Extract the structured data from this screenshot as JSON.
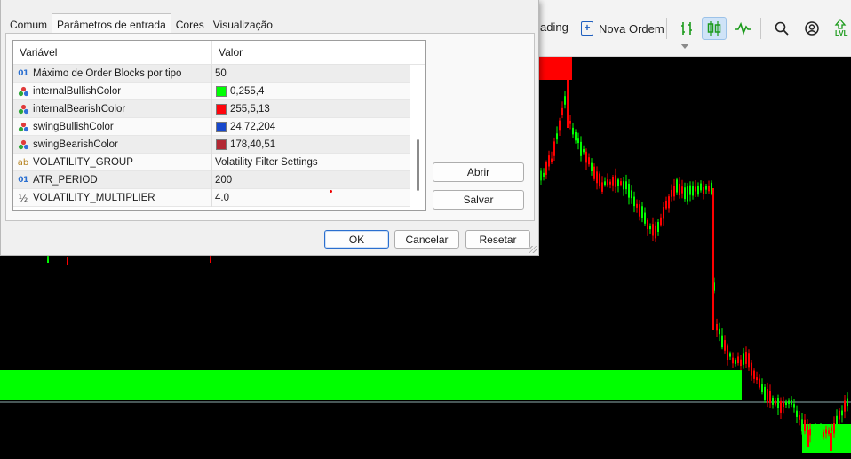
{
  "dialog": {
    "tabs": [
      {
        "label": "Comum",
        "active": false
      },
      {
        "label": "Parâmetros de entrada",
        "active": true
      },
      {
        "label": "Cores",
        "active": false
      },
      {
        "label": "Visualização",
        "active": false
      }
    ],
    "grid": {
      "header": {
        "variable": "Variável",
        "value": "Valor"
      },
      "rows": [
        {
          "type": "int",
          "type_glyph": "01",
          "name": "Máximo de Order Blocks por tipo",
          "value": "50"
        },
        {
          "type": "color",
          "type_glyph": "palette",
          "name": "internalBullishColor",
          "value": "0,255,4",
          "swatch": "#00ff04"
        },
        {
          "type": "color",
          "type_glyph": "palette",
          "name": "internalBearishColor",
          "value": "255,5,13",
          "swatch": "#ff050d"
        },
        {
          "type": "color",
          "type_glyph": "palette",
          "name": "swingBullishColor",
          "value": "24,72,204",
          "swatch": "#1848cc"
        },
        {
          "type": "color",
          "type_glyph": "palette",
          "name": "swingBearishColor",
          "value": "178,40,51",
          "swatch": "#b22833"
        },
        {
          "type": "string",
          "type_glyph": "ab",
          "name": "VOLATILITY_GROUP",
          "value": "Volatility Filter Settings"
        },
        {
          "type": "int",
          "type_glyph": "01",
          "name": "ATR_PERIOD",
          "value": "200"
        },
        {
          "type": "double",
          "type_glyph": "½",
          "name": "VOLATILITY_MULTIPLIER",
          "value": "4.0"
        }
      ]
    },
    "side_buttons": {
      "open": "Abrir",
      "save": "Salvar"
    },
    "buttons": {
      "ok": "OK",
      "cancel": "Cancelar",
      "reset": "Resetar"
    }
  },
  "toolbar": {
    "trading_label_partial": "ading",
    "new_order_label": "Nova Ordem",
    "lvl_label": "LVL",
    "icons": [
      "chart-bars-icon",
      "candlesticks-icon",
      "line-chart-icon",
      "search-icon",
      "account-icon",
      "levels-icon"
    ]
  },
  "colors": {
    "chart_background": "#000000",
    "bull_candle": "#00ff00",
    "bear_candle": "#ff0000",
    "order_block_bullish": "#00ff00",
    "order_block_bearish": "#ff0000",
    "price_line": "#8fb0b0",
    "accent": "#2b6fcf"
  }
}
